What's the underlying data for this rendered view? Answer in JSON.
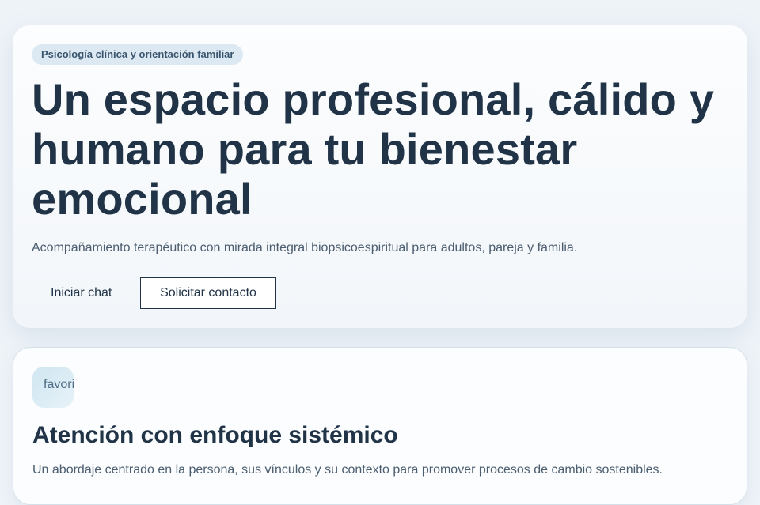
{
  "hero": {
    "badge": "Psicología clínica y orientación familiar",
    "title": "Un espacio profesional, cálido y humano para tu bienestar emocional",
    "subtitle": "Acompañamiento terapéutico con mirada integral biopsicoespiritual para adultos, pareja y familia.",
    "primary_button": "Iniciar chat",
    "secondary_button": "Solicitar contacto"
  },
  "feature_card": {
    "icon_text": "favorite",
    "icon_name": "favorite-icon",
    "title": "Atención con enfoque sistémico",
    "text": "Un abordaje centrado en la persona, sus vínculos y su contexto para promover procesos de cambio sostenibles."
  }
}
